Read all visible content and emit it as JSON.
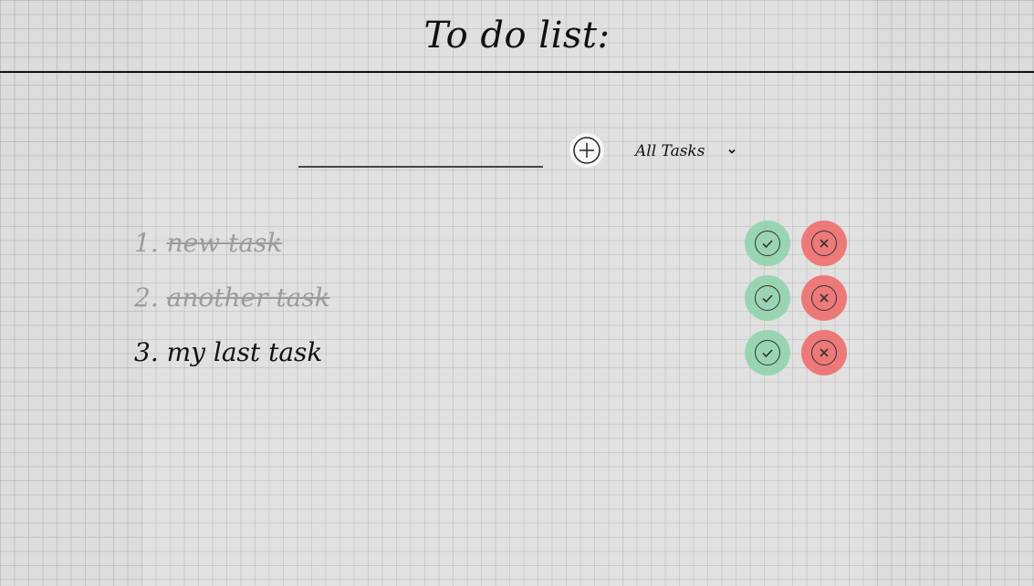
{
  "header": {
    "title": "To do list:"
  },
  "controls": {
    "input_value": "",
    "input_placeholder": "",
    "add_icon": "plus-circle-icon",
    "filter_selected": "All Tasks",
    "filter_icon": "chevron-down-icon"
  },
  "tasks": [
    {
      "number": "1.",
      "label": "new task",
      "status": "done"
    },
    {
      "number": "2.",
      "label": "another task",
      "status": "done"
    },
    {
      "number": "3.",
      "label": "my last task",
      "status": "active"
    }
  ],
  "actions": {
    "complete_icon": "check-icon",
    "delete_icon": "x-icon"
  },
  "colors": {
    "complete": "#8cd2aa",
    "delete": "#f06e6e",
    "text": "#111111",
    "done_text": "#9c9c9c",
    "grid_background": "#dcdcdc"
  }
}
